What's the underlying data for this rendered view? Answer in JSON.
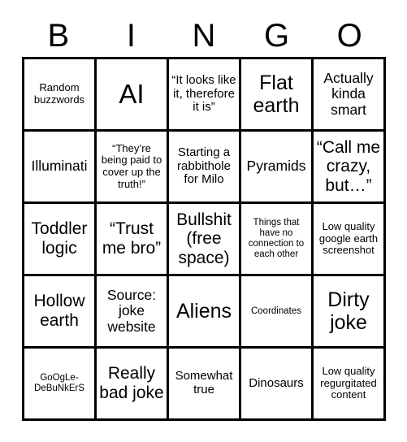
{
  "card": {
    "title": "BINGO",
    "header_letters": [
      "B",
      "I",
      "N",
      "G",
      "O"
    ],
    "free_space_cell": "r3c3",
    "colors": {
      "background": "#ffffff",
      "border": "#000000",
      "text": "#000000"
    },
    "rows": [
      [
        {
          "text": "Random buzzwords",
          "size": "s"
        },
        {
          "text": "AI",
          "size": "huge"
        },
        {
          "text": "“It looks like it, therefore it is”",
          "size": "m"
        },
        {
          "text": "Flat earth",
          "size": "xxl"
        },
        {
          "text": "Actually kinda smart",
          "size": "l"
        }
      ],
      [
        {
          "text": "Illuminati",
          "size": "l"
        },
        {
          "text": "“They’re being paid to cover up the truth!”",
          "size": "s"
        },
        {
          "text": "Starting a rabbithole for Milo",
          "size": "m"
        },
        {
          "text": "Pyramids",
          "size": "l"
        },
        {
          "text": "“Call me crazy, but…”",
          "size": "xl"
        }
      ],
      [
        {
          "text": "Toddler logic",
          "size": "xl"
        },
        {
          "text": "“Trust me bro”",
          "size": "xl"
        },
        {
          "text": "Bullshit (free space)",
          "size": "xl"
        },
        {
          "text": "Things that have no connection to each other",
          "size": "xs"
        },
        {
          "text": "Low quality google earth screenshot",
          "size": "s"
        }
      ],
      [
        {
          "text": "Hollow earth",
          "size": "xl"
        },
        {
          "text": "Source: joke website",
          "size": "l"
        },
        {
          "text": "Aliens",
          "size": "xxl"
        },
        {
          "text": "Coordinates",
          "size": "xs"
        },
        {
          "text": "Dirty joke",
          "size": "xxl"
        }
      ],
      [
        {
          "text": "GoOgLe-DeBuNkErS",
          "size": "xs"
        },
        {
          "text": "Really bad joke",
          "size": "xl"
        },
        {
          "text": "Somewhat true",
          "size": "m"
        },
        {
          "text": "Dinosaurs",
          "size": "m"
        },
        {
          "text": "Low quality regurgitated content",
          "size": "s"
        }
      ]
    ]
  }
}
